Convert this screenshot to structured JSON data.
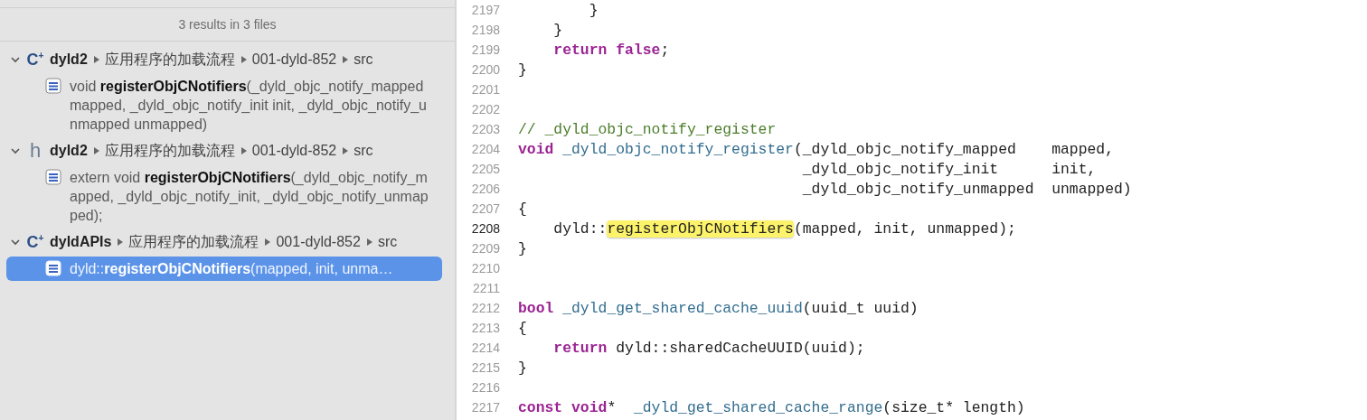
{
  "results_panel": {
    "summary": "3 results in 3 files",
    "groups": [
      {
        "badge": "C$^{+}$",
        "file": "dyld2",
        "crumbs": [
          "应用程序的加载流程",
          "001-dyld-852",
          "src"
        ],
        "expanded": true,
        "results": [
          {
            "text": "void **registerObjCNotifiers**(_dyld_objc_notify_mapped mapped, _dyld_objc_notify_init init, _dyld_objc_notify_unmapped unmapped)",
            "selected": false
          }
        ]
      },
      {
        "badge": "h",
        "file": "dyld2",
        "crumbs": [
          "应用程序的加载流程",
          "001-dyld-852",
          "src"
        ],
        "expanded": true,
        "results": [
          {
            "text": "extern void **registerObjCNotifiers**(_dyld_objc_notify_mapped, _dyld_objc_notify_init, _dyld_objc_notify_unmapped);",
            "selected": false
          }
        ]
      },
      {
        "badge": "C$^{+}$",
        "file": "dyldAPIs",
        "crumbs": [
          "应用程序的加载流程",
          "001-dyld-852",
          "src"
        ],
        "expanded": true,
        "results": [
          {
            "text": "dyld::**registerObjCNotifiers**(mapped, init, unma…",
            "selected": true
          }
        ]
      }
    ]
  },
  "editor": {
    "lines": [
      {
        "number": "2197",
        "current": false,
        "segments": [
          {
            "kind": "plain",
            "text": "        }"
          }
        ]
      },
      {
        "number": "2198",
        "current": false,
        "segments": [
          {
            "kind": "plain",
            "text": "    }"
          }
        ]
      },
      {
        "number": "2199",
        "current": false,
        "segments": [
          {
            "kind": "keyword",
            "text": "    return false"
          },
          {
            "kind": "plain",
            "text": ";"
          }
        ]
      },
      {
        "number": "2200",
        "current": false,
        "segments": [
          {
            "kind": "plain",
            "text": "}"
          }
        ]
      },
      {
        "number": "2201",
        "current": false
      },
      {
        "number": "2202",
        "current": false
      },
      {
        "number": "2203",
        "current": false,
        "segments": [
          {
            "kind": "comment",
            "text": "// _dyld_objc_notify_register"
          }
        ]
      },
      {
        "number": "2204",
        "current": false,
        "segments": [
          {
            "kind": "keyword",
            "text": "void"
          },
          {
            "kind": "function",
            "text": " _dyld_objc_notify_register"
          },
          {
            "kind": "plain",
            "text": "(_dyld_objc_notify_mapped    mapped,"
          }
        ]
      },
      {
        "number": "2205",
        "current": false,
        "segments": [
          {
            "kind": "plain",
            "text": "                                _dyld_objc_notify_init      init,"
          }
        ]
      },
      {
        "number": "2206",
        "current": false,
        "segments": [
          {
            "kind": "plain",
            "text": "                                _dyld_objc_notify_unmapped  unmapped)"
          }
        ]
      },
      {
        "number": "2207",
        "current": false,
        "segments": [
          {
            "kind": "plain",
            "text": "{"
          }
        ]
      },
      {
        "number": "2208",
        "current": true,
        "segments": [
          {
            "kind": "plain",
            "text": "    dyld::"
          },
          {
            "kind": "match",
            "text": "registerObjCNotifiers"
          },
          {
            "kind": "plain",
            "text": "(mapped, init, unmapped);"
          }
        ]
      },
      {
        "number": "2209",
        "current": false,
        "segments": [
          {
            "kind": "plain",
            "text": "}"
          }
        ]
      },
      {
        "number": "2210",
        "current": false
      },
      {
        "number": "2211",
        "current": false
      },
      {
        "number": "2212",
        "current": false,
        "segments": [
          {
            "kind": "keyword",
            "text": "bool"
          },
          {
            "kind": "function",
            "text": " _dyld_get_shared_cache_uuid"
          },
          {
            "kind": "plain",
            "text": "(uuid_t uuid)"
          }
        ]
      },
      {
        "number": "2213",
        "current": false,
        "segments": [
          {
            "kind": "plain",
            "text": "{"
          }
        ]
      },
      {
        "number": "2214",
        "current": false,
        "segments": [
          {
            "kind": "keyword",
            "text": "    return"
          },
          {
            "kind": "plain",
            "text": " dyld::sharedCacheUUID(uuid);"
          }
        ]
      },
      {
        "number": "2215",
        "current": false,
        "segments": [
          {
            "kind": "plain",
            "text": "}"
          }
        ]
      },
      {
        "number": "2216",
        "current": false
      },
      {
        "number": "2217",
        "current": false,
        "segments": [
          {
            "kind": "keyword",
            "text": "const void"
          },
          {
            "kind": "plain",
            "text": "*  "
          },
          {
            "kind": "function",
            "text": "_dyld_get_shared_cache_range"
          },
          {
            "kind": "plain",
            "text": "(size_t* length)"
          }
        ]
      }
    ]
  }
}
